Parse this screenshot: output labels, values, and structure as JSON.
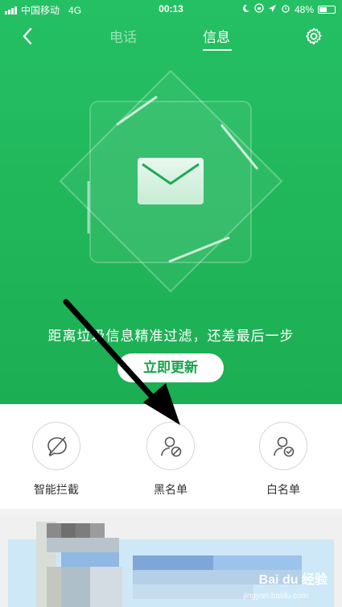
{
  "status_bar": {
    "carrier": "中国移动",
    "network": "4G",
    "time": "00:13",
    "battery": "48%",
    "battery_level": 0.48
  },
  "nav": {
    "tabs": [
      {
        "label": "电话"
      },
      {
        "label": "信息"
      }
    ]
  },
  "hero": {
    "tagline": "距离垃圾信息精准过滤，还差最后一步",
    "update_button": "立即更新"
  },
  "features": [
    {
      "label": "智能拦截",
      "icon": "chat-block-icon"
    },
    {
      "label": "黑名单",
      "icon": "user-block-icon"
    },
    {
      "label": "白名单",
      "icon": "user-check-icon"
    }
  ],
  "watermark": {
    "brand": "Bai du 经验",
    "url": "jingyan.baidu.com"
  },
  "colors": {
    "primary_green": "#1fb85a",
    "button_text": "#16a34a"
  }
}
